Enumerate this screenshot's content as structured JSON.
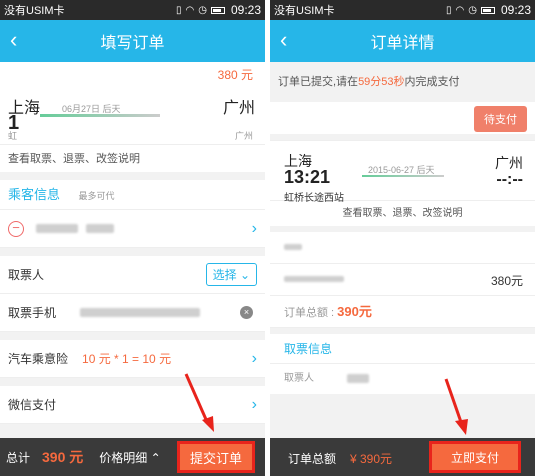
{
  "left": {
    "status": {
      "carrier": "没有USIM卡",
      "time": "09:23"
    },
    "title": "填写订单",
    "price": "380 元",
    "route": {
      "from": "上海",
      "to": "广州",
      "time_partial": "1",
      "date_partial": "06月27日 后天",
      "station_from_partial": "虹",
      "station_to": "广州"
    },
    "notice_link": "查看取票、退票、改签说明",
    "passenger": {
      "heading": "乘客信息",
      "hint": "最多可代"
    },
    "ticket_taker": {
      "label": "取票人",
      "button": "选择"
    },
    "phone": {
      "label": "取票手机"
    },
    "insurance": {
      "label": "汽车乘意险",
      "value": "10 元 * 1 = 10 元"
    },
    "payment": {
      "label": "微信支付"
    },
    "bottom": {
      "total_label": "总计",
      "amount": "390 元",
      "detail": "价格明细",
      "submit": "提交订单"
    }
  },
  "right": {
    "status": {
      "carrier": "没有USIM卡",
      "time": "09:23"
    },
    "title": "订单详情",
    "notice_pre": "订单已提交,请在",
    "countdown": "59分53秒",
    "notice_post": "内完成支付",
    "status_badge": "待支付",
    "route": {
      "from": "上海",
      "time": "13:21",
      "station": "虹桥长途西站",
      "date": "2015-06-27 后天",
      "to": "广州",
      "to_time": "--:--"
    },
    "notice_link": "查看取票、退票、改签说明",
    "price": "380元",
    "total_label": "订单总额 : ",
    "total_value": "390元",
    "ticket_info": "取票信息",
    "taker_label": "取票人",
    "bottom": {
      "label": "订单总额",
      "amount": "¥ 390元",
      "pay": "立即支付"
    }
  },
  "accent": "#26b6e8",
  "highlight": "#f5693e",
  "annotation_color": "#e8241c"
}
